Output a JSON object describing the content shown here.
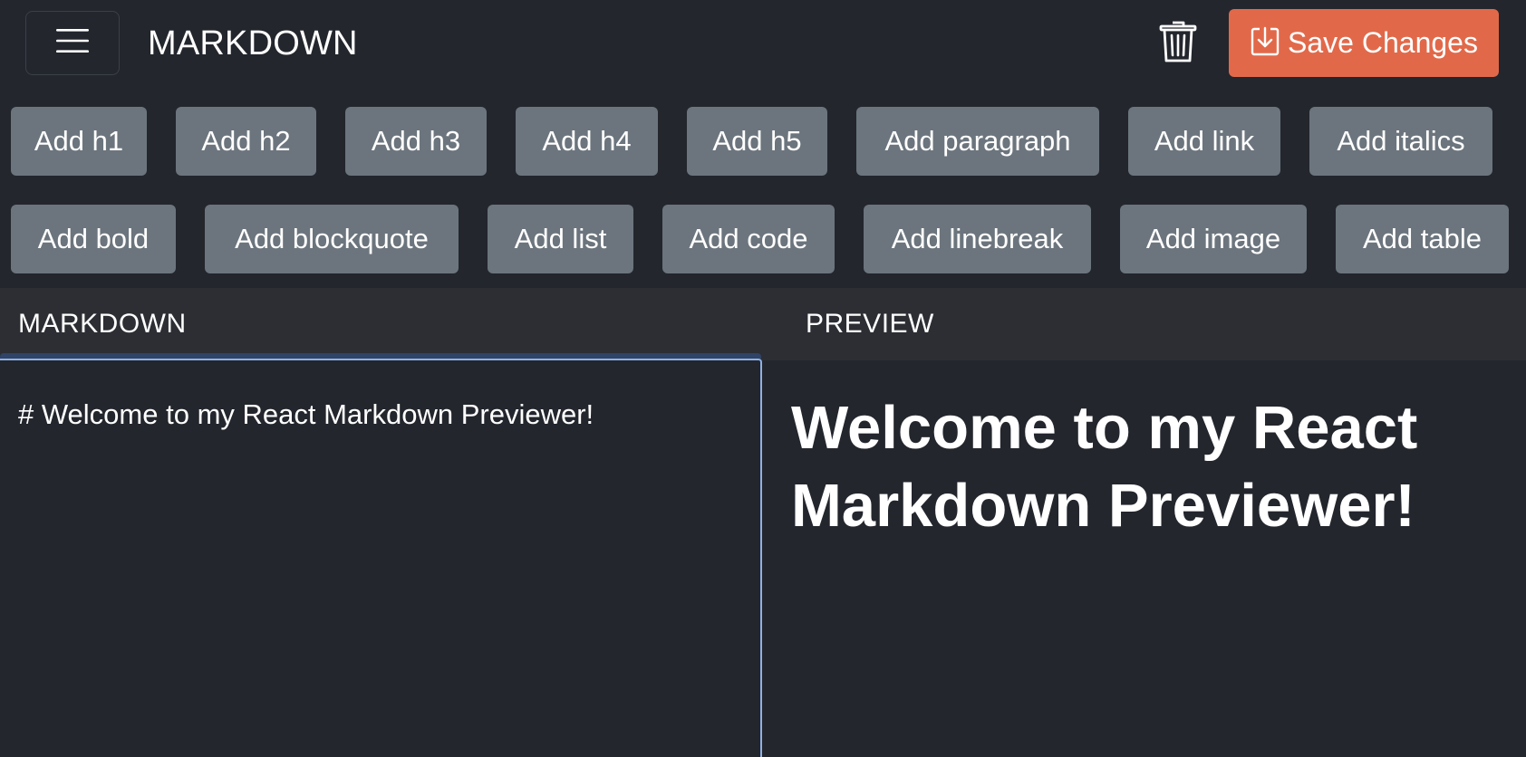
{
  "header": {
    "title": "MARKDOWN",
    "save_label": "Save Changes",
    "icons": {
      "menu": "hamburger-menu-icon",
      "trash": "trash-icon",
      "save": "download-icon"
    },
    "save_color": "#e1694a"
  },
  "toolbar": {
    "row1": [
      "Add h1",
      "Add h2",
      "Add h3",
      "Add h4",
      "Add h5",
      "Add paragraph",
      "Add link",
      "Add italics"
    ],
    "row2": [
      "Add bold",
      "Add blockquote",
      "Add list",
      "Add code",
      "Add linebreak",
      "Add image",
      "Add table"
    ]
  },
  "panels": {
    "markdown_label": "MARKDOWN",
    "preview_label": "PREVIEW"
  },
  "editor": {
    "value": "# Welcome to my React Markdown Previewer!"
  },
  "preview": {
    "h1": "Welcome to my React Markdown Previewer!"
  }
}
